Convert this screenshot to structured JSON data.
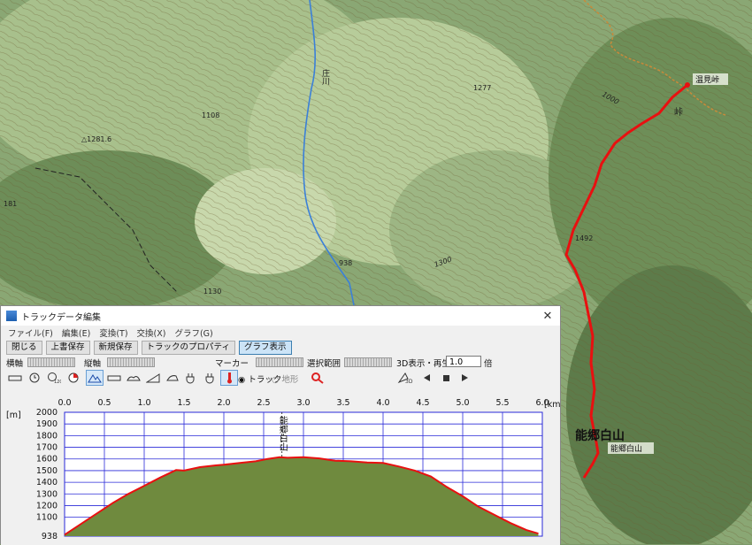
{
  "map": {
    "labels": {
      "river": "庄川",
      "peak1281": "△1281.6",
      "e1108": "1108",
      "e181": "181",
      "e1130": "1130",
      "e938": "938",
      "e1277": "1277",
      "e1492": "1492",
      "e1300": "1300",
      "e1000": "1000",
      "onsen": "温見峠",
      "pass": "峠",
      "nougouhakusan_big": "能郷白山",
      "nougouhakusan_small": "能郷白山"
    }
  },
  "window": {
    "title": "トラックデータ編集",
    "close": "✕",
    "menu": [
      "ファイル(F)",
      "編集(E)",
      "変換(T)",
      "交換(X)",
      "グラフ(G)"
    ],
    "buttons": {
      "close_btn": "閉じる",
      "overwrite": "上書保存",
      "save_new": "新規保存",
      "properties": "トラックのプロパティ",
      "graph_view": "グラフ表示"
    },
    "controls": {
      "h_axis": "横軸",
      "v_axis": "縦軸",
      "marker": "マーカー",
      "selection": "選択範囲",
      "view3d": "3D表示・再生",
      "speed": "1.0",
      "times": "倍",
      "track_radio": "トラック",
      "terrain_radio": "地形",
      "btn3d": "3D"
    }
  },
  "chart_data": {
    "type": "area",
    "xlabel_unit": "[km]",
    "ylabel_unit": "[m]",
    "x_ticks": [
      "0.0",
      "0.5",
      "1.0",
      "1.5",
      "2.0",
      "2.5",
      "3.0",
      "3.5",
      "4.0",
      "4.5",
      "5.0",
      "5.5",
      "6.0"
    ],
    "y_ticks": [
      "2000",
      "1900",
      "1800",
      "1700",
      "1600",
      "1500",
      "1400",
      "1300",
      "1200",
      "1100"
    ],
    "y_min_label": "938",
    "xlim": [
      0,
      6.0
    ],
    "ylim": [
      938,
      2000
    ],
    "annotation": "能郷白山",
    "annotation_x": 2.73,
    "fill_color": "#6f8a3e",
    "line_color": "#e81010",
    "grid_color": "#2a2ad8",
    "x": [
      0.0,
      0.2,
      0.4,
      0.6,
      0.8,
      1.0,
      1.2,
      1.4,
      1.5,
      1.7,
      1.9,
      2.0,
      2.2,
      2.4,
      2.55,
      2.7,
      2.8,
      3.0,
      3.2,
      3.4,
      3.6,
      3.8,
      4.0,
      4.2,
      4.4,
      4.6,
      4.8,
      5.0,
      5.2,
      5.4,
      5.6,
      5.8,
      5.95
    ],
    "y": [
      950,
      1040,
      1130,
      1220,
      1300,
      1370,
      1440,
      1505,
      1500,
      1530,
      1545,
      1550,
      1565,
      1580,
      1600,
      1615,
      1610,
      1615,
      1605,
      1585,
      1580,
      1570,
      1565,
      1535,
      1500,
      1450,
      1360,
      1280,
      1190,
      1120,
      1050,
      990,
      960
    ]
  }
}
